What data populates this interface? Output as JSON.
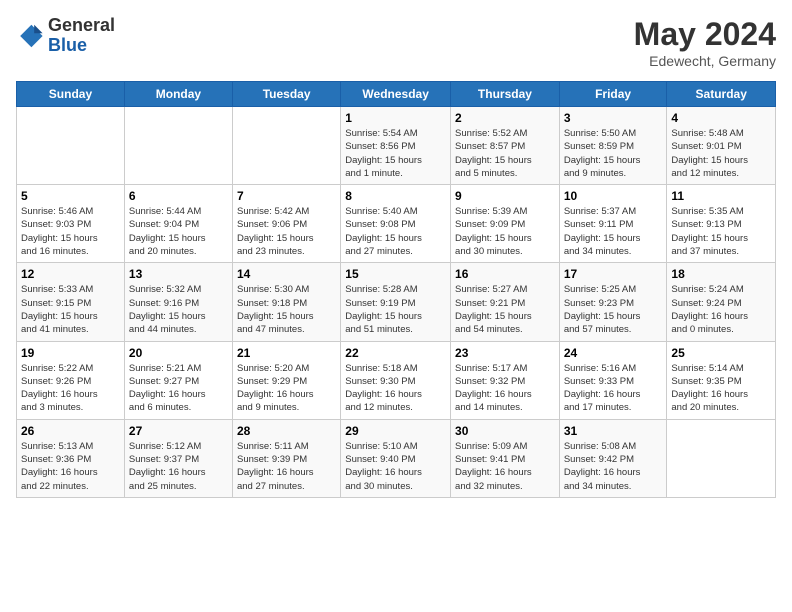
{
  "header": {
    "logo_general": "General",
    "logo_blue": "Blue",
    "title": "May 2024",
    "subtitle": "Edewecht, Germany"
  },
  "days_of_week": [
    "Sunday",
    "Monday",
    "Tuesday",
    "Wednesday",
    "Thursday",
    "Friday",
    "Saturday"
  ],
  "weeks": [
    [
      {
        "day": "",
        "content": ""
      },
      {
        "day": "",
        "content": ""
      },
      {
        "day": "",
        "content": ""
      },
      {
        "day": "1",
        "content": "Sunrise: 5:54 AM\nSunset: 8:56 PM\nDaylight: 15 hours\nand 1 minute."
      },
      {
        "day": "2",
        "content": "Sunrise: 5:52 AM\nSunset: 8:57 PM\nDaylight: 15 hours\nand 5 minutes."
      },
      {
        "day": "3",
        "content": "Sunrise: 5:50 AM\nSunset: 8:59 PM\nDaylight: 15 hours\nand 9 minutes."
      },
      {
        "day": "4",
        "content": "Sunrise: 5:48 AM\nSunset: 9:01 PM\nDaylight: 15 hours\nand 12 minutes."
      }
    ],
    [
      {
        "day": "5",
        "content": "Sunrise: 5:46 AM\nSunset: 9:03 PM\nDaylight: 15 hours\nand 16 minutes."
      },
      {
        "day": "6",
        "content": "Sunrise: 5:44 AM\nSunset: 9:04 PM\nDaylight: 15 hours\nand 20 minutes."
      },
      {
        "day": "7",
        "content": "Sunrise: 5:42 AM\nSunset: 9:06 PM\nDaylight: 15 hours\nand 23 minutes."
      },
      {
        "day": "8",
        "content": "Sunrise: 5:40 AM\nSunset: 9:08 PM\nDaylight: 15 hours\nand 27 minutes."
      },
      {
        "day": "9",
        "content": "Sunrise: 5:39 AM\nSunset: 9:09 PM\nDaylight: 15 hours\nand 30 minutes."
      },
      {
        "day": "10",
        "content": "Sunrise: 5:37 AM\nSunset: 9:11 PM\nDaylight: 15 hours\nand 34 minutes."
      },
      {
        "day": "11",
        "content": "Sunrise: 5:35 AM\nSunset: 9:13 PM\nDaylight: 15 hours\nand 37 minutes."
      }
    ],
    [
      {
        "day": "12",
        "content": "Sunrise: 5:33 AM\nSunset: 9:15 PM\nDaylight: 15 hours\nand 41 minutes."
      },
      {
        "day": "13",
        "content": "Sunrise: 5:32 AM\nSunset: 9:16 PM\nDaylight: 15 hours\nand 44 minutes."
      },
      {
        "day": "14",
        "content": "Sunrise: 5:30 AM\nSunset: 9:18 PM\nDaylight: 15 hours\nand 47 minutes."
      },
      {
        "day": "15",
        "content": "Sunrise: 5:28 AM\nSunset: 9:19 PM\nDaylight: 15 hours\nand 51 minutes."
      },
      {
        "day": "16",
        "content": "Sunrise: 5:27 AM\nSunset: 9:21 PM\nDaylight: 15 hours\nand 54 minutes."
      },
      {
        "day": "17",
        "content": "Sunrise: 5:25 AM\nSunset: 9:23 PM\nDaylight: 15 hours\nand 57 minutes."
      },
      {
        "day": "18",
        "content": "Sunrise: 5:24 AM\nSunset: 9:24 PM\nDaylight: 16 hours\nand 0 minutes."
      }
    ],
    [
      {
        "day": "19",
        "content": "Sunrise: 5:22 AM\nSunset: 9:26 PM\nDaylight: 16 hours\nand 3 minutes."
      },
      {
        "day": "20",
        "content": "Sunrise: 5:21 AM\nSunset: 9:27 PM\nDaylight: 16 hours\nand 6 minutes."
      },
      {
        "day": "21",
        "content": "Sunrise: 5:20 AM\nSunset: 9:29 PM\nDaylight: 16 hours\nand 9 minutes."
      },
      {
        "day": "22",
        "content": "Sunrise: 5:18 AM\nSunset: 9:30 PM\nDaylight: 16 hours\nand 12 minutes."
      },
      {
        "day": "23",
        "content": "Sunrise: 5:17 AM\nSunset: 9:32 PM\nDaylight: 16 hours\nand 14 minutes."
      },
      {
        "day": "24",
        "content": "Sunrise: 5:16 AM\nSunset: 9:33 PM\nDaylight: 16 hours\nand 17 minutes."
      },
      {
        "day": "25",
        "content": "Sunrise: 5:14 AM\nSunset: 9:35 PM\nDaylight: 16 hours\nand 20 minutes."
      }
    ],
    [
      {
        "day": "26",
        "content": "Sunrise: 5:13 AM\nSunset: 9:36 PM\nDaylight: 16 hours\nand 22 minutes."
      },
      {
        "day": "27",
        "content": "Sunrise: 5:12 AM\nSunset: 9:37 PM\nDaylight: 16 hours\nand 25 minutes."
      },
      {
        "day": "28",
        "content": "Sunrise: 5:11 AM\nSunset: 9:39 PM\nDaylight: 16 hours\nand 27 minutes."
      },
      {
        "day": "29",
        "content": "Sunrise: 5:10 AM\nSunset: 9:40 PM\nDaylight: 16 hours\nand 30 minutes."
      },
      {
        "day": "30",
        "content": "Sunrise: 5:09 AM\nSunset: 9:41 PM\nDaylight: 16 hours\nand 32 minutes."
      },
      {
        "day": "31",
        "content": "Sunrise: 5:08 AM\nSunset: 9:42 PM\nDaylight: 16 hours\nand 34 minutes."
      },
      {
        "day": "",
        "content": ""
      }
    ]
  ]
}
